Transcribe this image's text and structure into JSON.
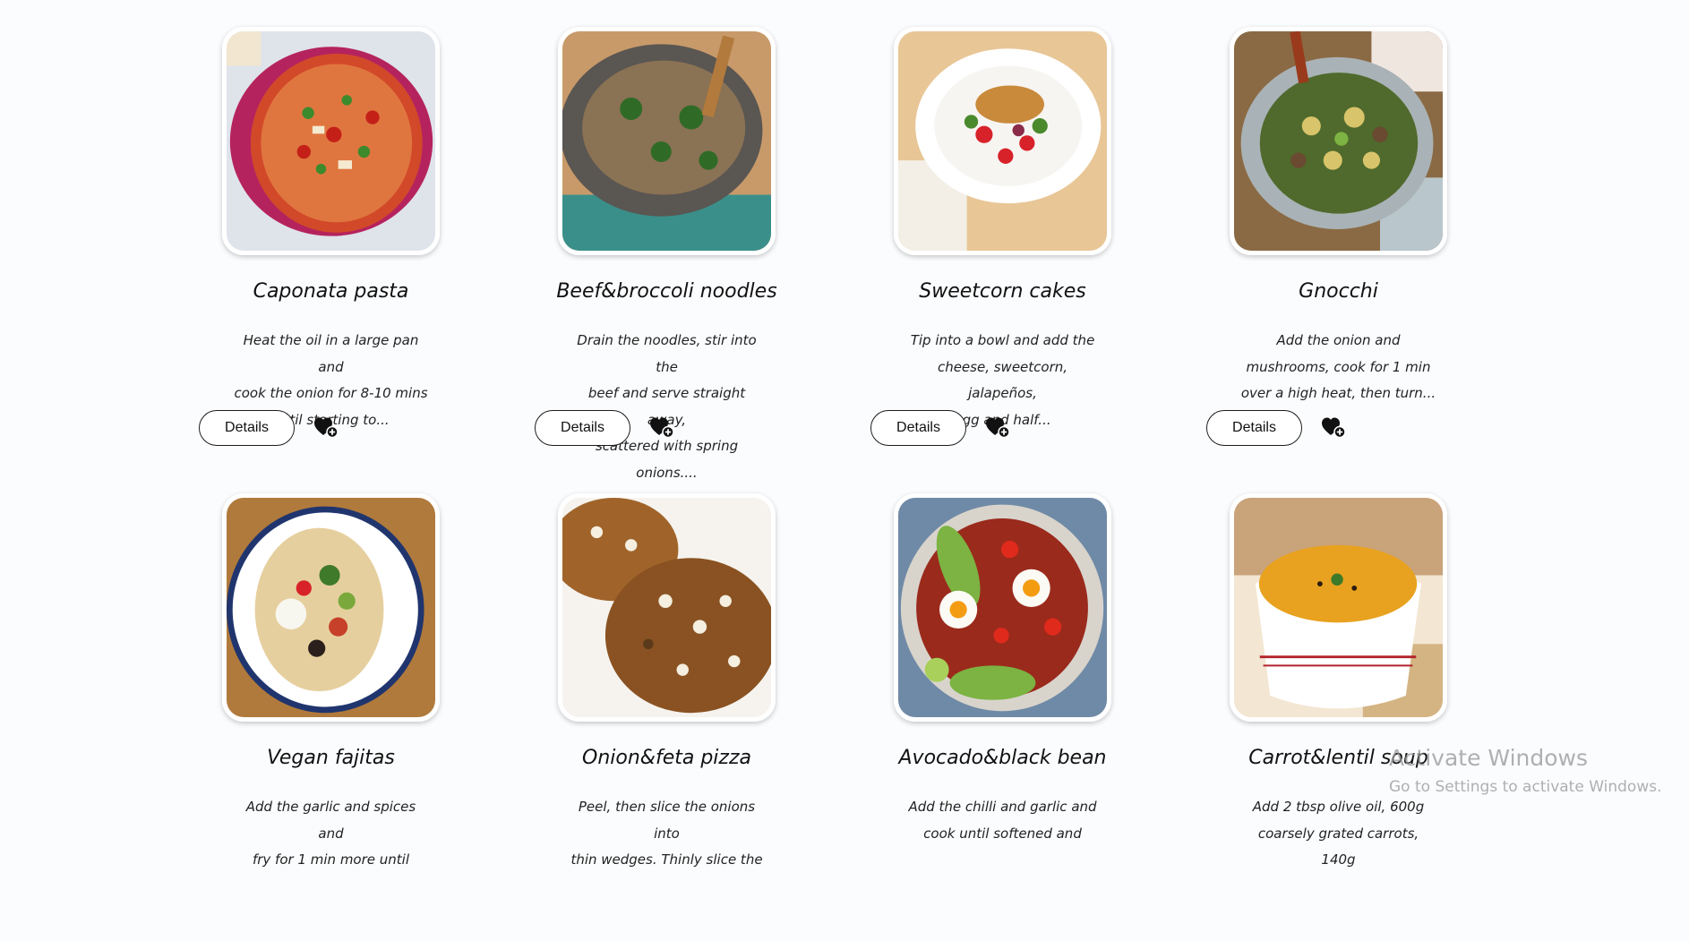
{
  "recipes": [
    {
      "title": "Caponata pasta",
      "desc": [
        "Heat the oil in a large pan and",
        "cook the onion for 8-10 mins",
        "until starting to..."
      ],
      "details_label": "Details",
      "favorite_icon": "heart-plus-icon"
    },
    {
      "title": "Beef&broccoli noodles",
      "desc": [
        "Drain the noodles, stir into the",
        "beef and serve straight away,",
        "scattered with spring onions...."
      ],
      "details_label": "Details",
      "favorite_icon": "heart-plus-icon"
    },
    {
      "title": "Sweetcorn cakes",
      "desc": [
        "Tip into a bowl and add the",
        "cheese, sweetcorn, jalapeños,",
        "egg and half..."
      ],
      "details_label": "Details",
      "favorite_icon": "heart-plus-icon"
    },
    {
      "title": "Gnocchi",
      "desc": [
        "Add the onion and",
        "mushrooms, cook for 1 min",
        "over a high heat, then turn..."
      ],
      "details_label": "Details",
      "favorite_icon": "heart-plus-icon"
    },
    {
      "title": "Vegan fajitas",
      "desc": [
        "Add the garlic and spices and",
        "fry for 1 min more until"
      ]
    },
    {
      "title": "Onion&feta pizza",
      "desc": [
        "Peel, then slice the onions into",
        "thin wedges. Thinly slice the"
      ]
    },
    {
      "title": "Avocado&black bean",
      "desc": [
        "Add the chilli and garlic and",
        "cook until softened and"
      ]
    },
    {
      "title": "Carrot&lentil soup",
      "desc": [
        "Add 2 tbsp olive oil, 600g",
        "coarsely grated carrots, 140g"
      ]
    }
  ],
  "watermark": {
    "title": "Activate Windows",
    "subtitle": "Go to Settings to activate Windows."
  }
}
